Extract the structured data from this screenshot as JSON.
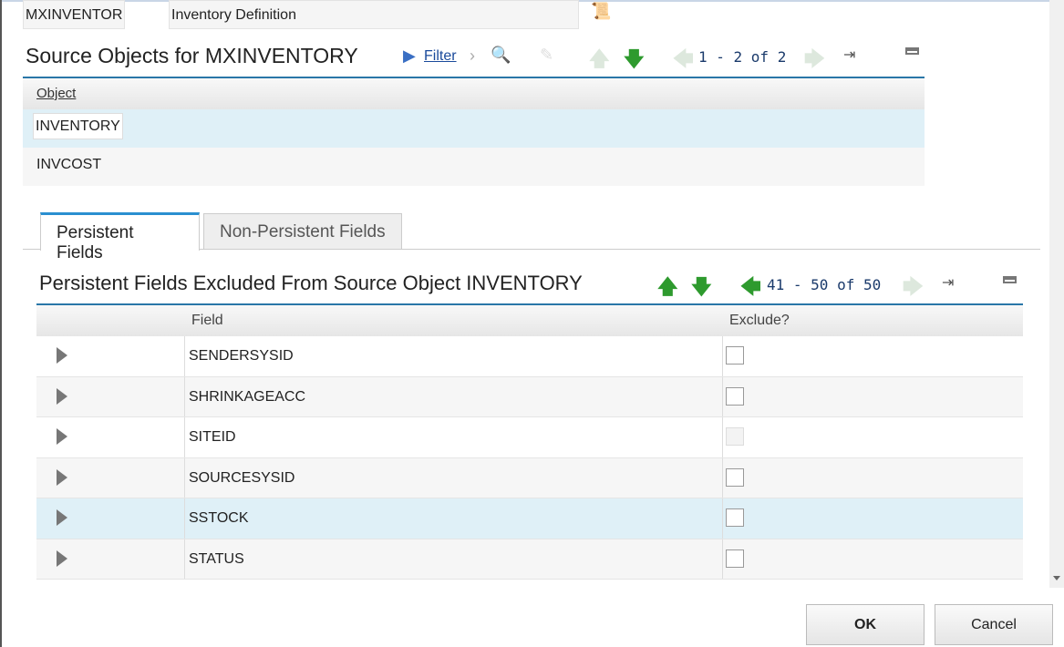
{
  "header": {
    "object_name": "MXINVENTOR",
    "description": "Inventory Definition"
  },
  "source_objects": {
    "title": "Source Objects for MXINVENTORY",
    "filter_label": "Filter",
    "pager": "1 - 2 of 2",
    "column": "Object",
    "rows": [
      "INVENTORY",
      "INVCOST"
    ]
  },
  "tabs": [
    "Persistent Fields",
    "Non-Persistent Fields"
  ],
  "fields": {
    "title": "Persistent Fields Excluded From Source Object INVENTORY",
    "pager": "41 - 50 of 50",
    "columns": [
      "Field",
      "Exclude?"
    ],
    "rows": [
      {
        "field": "SENDERSYSID",
        "disabled": false
      },
      {
        "field": "SHRINKAGEACC",
        "disabled": false
      },
      {
        "field": "SITEID",
        "disabled": true
      },
      {
        "field": "SOURCESYSID",
        "disabled": false
      },
      {
        "field": "SSTOCK",
        "disabled": false
      },
      {
        "field": "STATUS",
        "disabled": false
      }
    ]
  },
  "buttons": {
    "ok": "OK",
    "cancel": "Cancel"
  }
}
